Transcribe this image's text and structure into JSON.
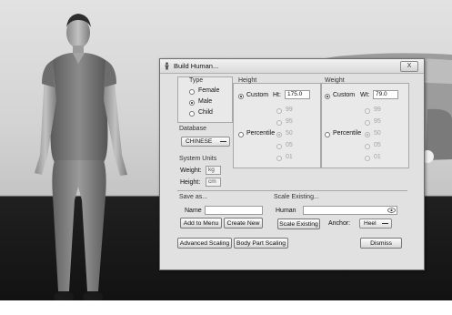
{
  "dialog": {
    "title": "Build Human...",
    "close_label": "X",
    "type": {
      "label": "Type",
      "options": [
        {
          "label": "Female",
          "selected": false
        },
        {
          "label": "Male",
          "selected": true
        },
        {
          "label": "Child",
          "selected": false
        }
      ]
    },
    "database": {
      "label": "Database",
      "selected": "CHINESE"
    },
    "system_units": {
      "label": "System Units",
      "weight_label": "Weight:",
      "weight_value": "kg",
      "height_label": "Height:",
      "height_value": "cm"
    },
    "height": {
      "label": "Height",
      "custom_label": "Custom",
      "field_label": "Ht:",
      "field_value": "175.0",
      "percentile_label": "Percentile",
      "percentiles": [
        "99",
        "95",
        "50",
        "05",
        "01"
      ],
      "mode": "custom"
    },
    "weight": {
      "label": "Weight",
      "custom_label": "Custom",
      "field_label": "Wt:",
      "field_value": "79.0",
      "percentile_label": "Percentile",
      "percentiles": [
        "99",
        "95",
        "50",
        "05",
        "01"
      ],
      "mode": "custom"
    },
    "save_as": {
      "label": "Save as...",
      "name_label": "Name",
      "name_value": "",
      "add_to_menu_label": "Add to Menu",
      "create_new_label": "Create New"
    },
    "scale_existing": {
      "label": "Scale Existing...",
      "human_label": "Human",
      "human_value": "",
      "scale_existing_label": "Scale Existing",
      "anchor_label": "Anchor:",
      "anchor_value": "Heel"
    },
    "advanced_scaling_label": "Advanced Scaling",
    "body_part_scaling_label": "Body Part Scaling",
    "dismiss_label": "Dismiss"
  },
  "colors": {
    "dialog_bg": "#e1e1e1",
    "group_bg": "#e9e9e9",
    "floor": "#141414",
    "sky": "#d3d3d3"
  },
  "icons": {
    "title_icon": "human-figure-icon",
    "close_icon": "close-icon",
    "combo_arrow": "chevron-down-icon",
    "pick_icon": "eye-pick-icon"
  }
}
